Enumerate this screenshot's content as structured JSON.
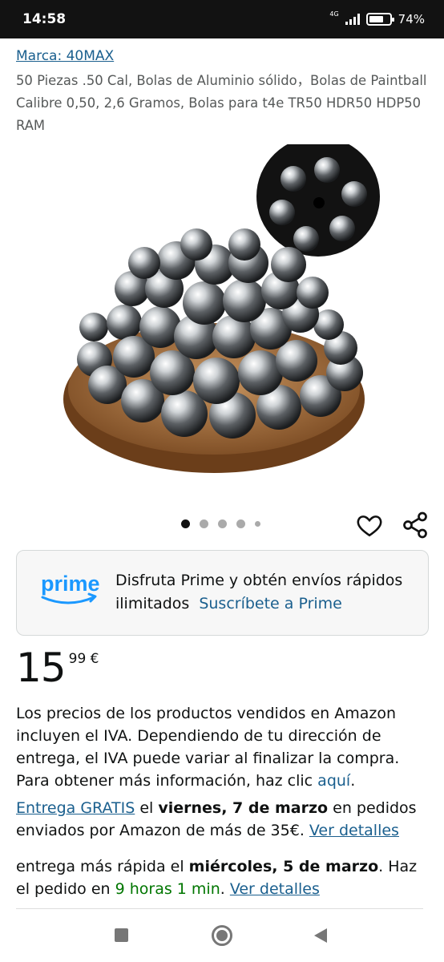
{
  "status_bar": {
    "time": "14:58",
    "network": "4G",
    "battery_percent": "74%",
    "battery_level": 0.74
  },
  "product": {
    "brand_link": "Marca: 40MAX",
    "title": "50 Piezas .50 Cal, Bolas de Aluminio sólido，Bolas de Paintball Calibre 0,50, 2,6 Gramos, Bolas para t4e TR50 HDR50 HDP50 RAM",
    "image_icon": "product-photo-steel-balls",
    "carousel": {
      "total_dots": 5,
      "active_index": 0
    }
  },
  "actions": {
    "wishlist_icon": "heart-icon",
    "share_icon": "share-icon"
  },
  "prime": {
    "logo_text": "prime",
    "message": "Disfruta Prime y obtén envíos rápidos ilimitados",
    "cta": "Suscríbete a Prime",
    "accent_color": "#1a98ff"
  },
  "price": {
    "whole": "15",
    "fraction": "99 €"
  },
  "vat_info": {
    "text": "Los precios de los productos vendidos en Amazon incluyen el IVA. Dependiendo de tu dirección de entrega, el IVA puede variar al finalizar la compra. Para obtener más información, haz clic",
    "link": "aquí",
    "end": "."
  },
  "delivery": {
    "free_link": "Entrega GRATIS",
    "pre_date": " el ",
    "date": "viernes, 7 de marzo",
    "post_date": " en pedidos enviados por Amazon de más de 35€. ",
    "details_link": "Ver detalles"
  },
  "fast_delivery": {
    "pre": "entrega más rápida el ",
    "date": "miércoles, 5 de marzo",
    "mid": ". Haz el pedido en ",
    "countdown": "9 horas 1 min",
    "post": ". ",
    "details_link": "Ver detalles"
  },
  "colors": {
    "link": "#1a5f8e",
    "green": "#007600",
    "text": "#0f1111"
  }
}
